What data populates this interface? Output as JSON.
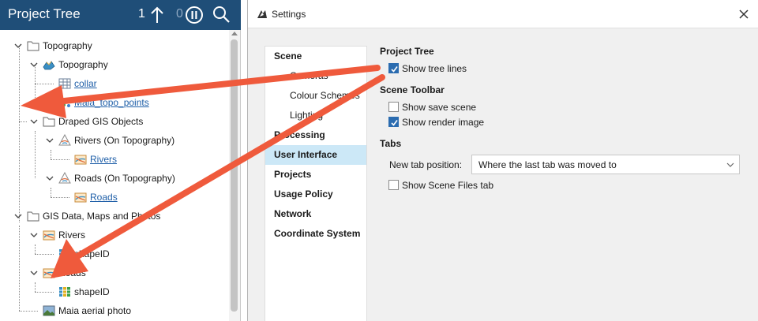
{
  "tree_panel": {
    "title": "Project Tree",
    "count_left": "1",
    "count_right": "0",
    "header_color": "#1f4e78",
    "items": [
      {
        "label": "Topography",
        "icon": "folder-icon",
        "link": false
      },
      {
        "label": "Topography",
        "icon": "terrain-surface-icon",
        "link": false
      },
      {
        "label": "collar",
        "icon": "table-icon",
        "link": true
      },
      {
        "label": "Maia_topo_points",
        "icon": "points-icon",
        "link": true
      },
      {
        "label": "Draped GIS Objects",
        "icon": "folder-icon",
        "link": false
      },
      {
        "label": "Rivers (On Topography)",
        "icon": "gis-layer-icon",
        "link": false
      },
      {
        "label": "Rivers",
        "icon": "gis-lines-icon",
        "link": true
      },
      {
        "label": "Roads (On Topography)",
        "icon": "gis-layer-icon",
        "link": false
      },
      {
        "label": "Roads",
        "icon": "gis-lines-icon",
        "link": true
      },
      {
        "label": "GIS Data, Maps and Photos",
        "icon": "folder-icon",
        "link": false
      },
      {
        "label": "Rivers",
        "icon": "gis-layer-icon",
        "link": false
      },
      {
        "label": "shapeID",
        "icon": "attribute-column-icon",
        "link": false
      },
      {
        "label": "Roads",
        "icon": "gis-layer-icon",
        "link": false
      },
      {
        "label": "shapeID",
        "icon": "attribute-column-icon",
        "link": false
      },
      {
        "label": "Maia aerial photo",
        "icon": "aerial-photo-icon",
        "link": false
      }
    ]
  },
  "settings": {
    "title": "Settings",
    "nav": {
      "scene": "Scene",
      "cameras": "Cameras",
      "colour_schemes": "Colour Schemes",
      "lighting": "Lighting",
      "processing": "Processing",
      "user_interface": "User Interface",
      "projects": "Projects",
      "usage_policy": "Usage Policy",
      "network": "Network",
      "coordinate_system": "Coordinate System"
    },
    "active_item": "User Interface",
    "active_color": "#cce8f7",
    "sections": {
      "project_tree": {
        "title": "Project Tree",
        "show_tree_lines": {
          "label": "Show tree lines",
          "checked": true
        }
      },
      "scene_toolbar": {
        "title": "Scene Toolbar",
        "show_save_scene": {
          "label": "Show save scene",
          "checked": false
        },
        "show_render_image": {
          "label": "Show render image",
          "checked": true
        }
      },
      "tabs": {
        "title": "Tabs",
        "new_tab_position_label": "New tab position:",
        "new_tab_position_value": "Where the last tab was moved to",
        "show_scene_files_tab": {
          "label": "Show Scene Files tab",
          "checked": false
        }
      }
    }
  },
  "annotation_arrow_color": "#ef5a3c"
}
